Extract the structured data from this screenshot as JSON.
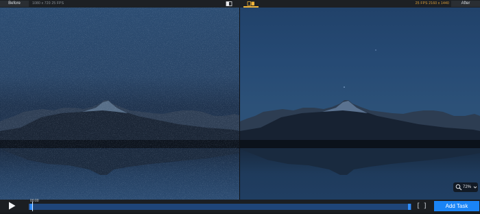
{
  "topbar": {
    "before_label": "Before",
    "before_info": "1080 x 720  25 FPS",
    "after_info": "25 FPS  2160 x 1440",
    "after_label": "After",
    "view_modes": [
      "split-view-icon",
      "side-by-side-icon"
    ],
    "accent_color": "#f0b43a"
  },
  "preview": {
    "zoom_level": "72%"
  },
  "timeline": {
    "current_time": "00:00",
    "progress": 0.005
  },
  "actions": {
    "add_task_label": "Add Task",
    "button_color": "#1a84f5"
  }
}
